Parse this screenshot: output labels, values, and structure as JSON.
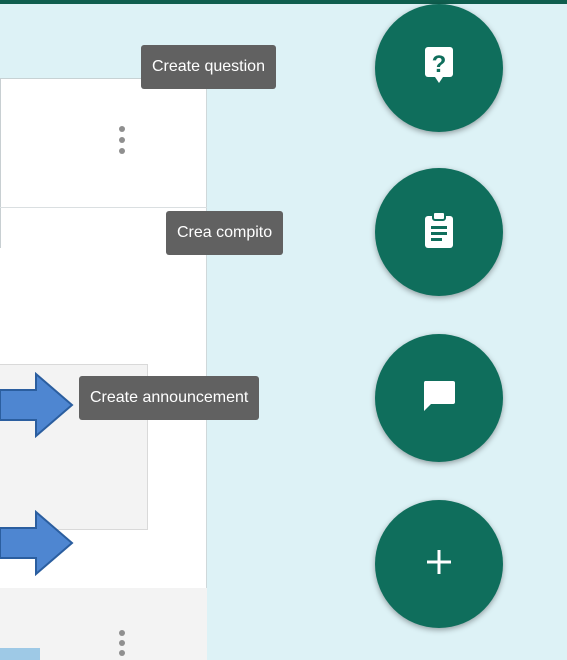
{
  "actions": {
    "create_question_label": "Create question",
    "create_assignment_label": "Crea compito",
    "create_announcement_label": "Create announcement"
  },
  "icons": {
    "question": "question-mark-icon",
    "assignment": "clipboard-icon",
    "announcement": "chat-bubble-icon",
    "add": "plus-icon",
    "overflow": "more-vert-icon",
    "annotation": "blue-arrow-icon"
  },
  "colors": {
    "fab": "#0f6e5c",
    "tooltip": "#616161",
    "panel": "#ddf2f6",
    "arrow": "#4e86d1"
  }
}
